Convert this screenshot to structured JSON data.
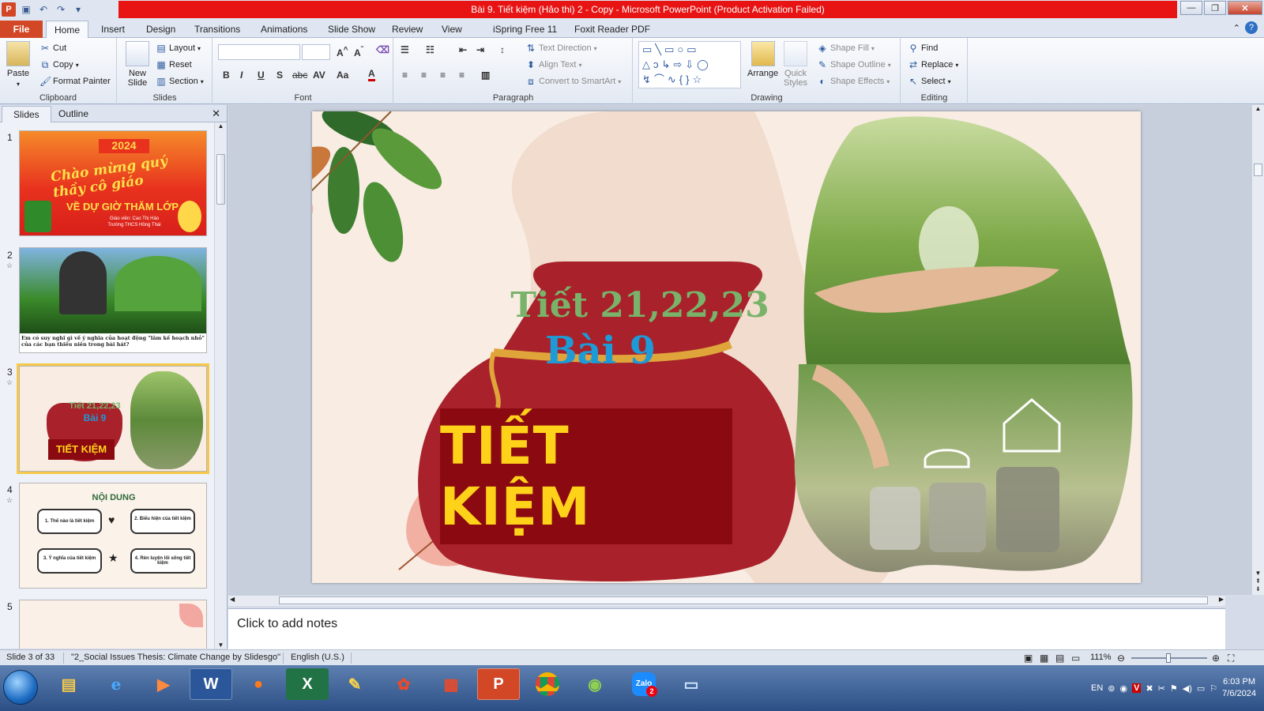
{
  "window": {
    "title": "Bài 9. Tiết kiệm (Hảo thi) 2 - Copy  -  Microsoft PowerPoint (Product Activation Failed)",
    "controls": [
      "minimize",
      "restore",
      "close"
    ]
  },
  "ribbon_tabs": [
    "File",
    "Home",
    "Insert",
    "Design",
    "Transitions",
    "Animations",
    "Slide Show",
    "Review",
    "View",
    "iSpring Free 11",
    "Foxit Reader PDF"
  ],
  "active_tab": "Home",
  "ribbon": {
    "clipboard": {
      "label": "Clipboard",
      "paste": "Paste",
      "cut": "Cut",
      "copy": "Copy",
      "format_painter": "Format Painter"
    },
    "slides": {
      "label": "Slides",
      "new_slide": "New Slide",
      "layout": "Layout",
      "reset": "Reset",
      "section": "Section"
    },
    "font": {
      "label": "Font",
      "font_name": "",
      "font_size": ""
    },
    "paragraph": {
      "label": "Paragraph",
      "text_direction": "Text Direction",
      "align_text": "Align Text",
      "convert_smartart": "Convert to SmartArt"
    },
    "drawing": {
      "label": "Drawing",
      "arrange": "Arrange",
      "quick_styles": "Quick Styles",
      "shape_fill": "Shape Fill",
      "shape_outline": "Shape Outline",
      "shape_effects": "Shape Effects"
    },
    "editing": {
      "label": "Editing",
      "find": "Find",
      "replace": "Replace",
      "select": "Select"
    }
  },
  "left_pane": {
    "tabs": [
      "Slides",
      "Outline"
    ],
    "active": "Slides",
    "thumbnails": [
      {
        "num": "1",
        "title": "Chào mừng quý thầy cô giáo",
        "year": "2024",
        "subtitle": "VỀ DỰ GIỜ THĂM LỚP",
        "teacher": "Giáo viên: Cao Thị Hảo",
        "school": "Trường THCS Hồng Thái"
      },
      {
        "num": "2",
        "caption": "Em có suy nghĩ gì về ý nghĩa của hoạt động \"lâm kế hoạch nhỏ\" của các bạn thiếu niên trong bài hát?"
      },
      {
        "num": "3",
        "line1": "Tiết 21,22,23",
        "line2": "Bài 9",
        "line3": "TIẾT KIỆM"
      },
      {
        "num": "4",
        "heading": "NỘI DUNG",
        "items": [
          "1. Thế nào là tiết kiệm",
          "2. Biểu hiện của tiết kiệm",
          "3. Ý nghĩa của tiết kiệm",
          "4. Rèn luyện lối sống tiết kiệm"
        ]
      },
      {
        "num": "5"
      }
    ]
  },
  "slide": {
    "line1": "Tiết 21,22,23",
    "line2": "Bài 9",
    "title": "TIẾT KIỆM"
  },
  "notes_placeholder": "Click to add notes",
  "status": {
    "slide_of": "Slide 3 of 33",
    "theme": "\"2_Social Issues Thesis: Climate Change by Slidesgo\"",
    "language": "English (U.S.)",
    "zoom": "111%"
  },
  "taskbar": {
    "language": "EN",
    "time": "6:03 PM",
    "date": "7/6/2024",
    "zalo_badge": "2"
  },
  "colors": {
    "title_red": "#e81414",
    "file_tab": "#d24726",
    "slide_bg": "#f8ece3",
    "bag_red": "#a8212b",
    "title_box": "#8b0a12",
    "title_text": "#ffd21a",
    "line1_green": "#79b36a",
    "line2_blue": "#1e9ad6"
  }
}
